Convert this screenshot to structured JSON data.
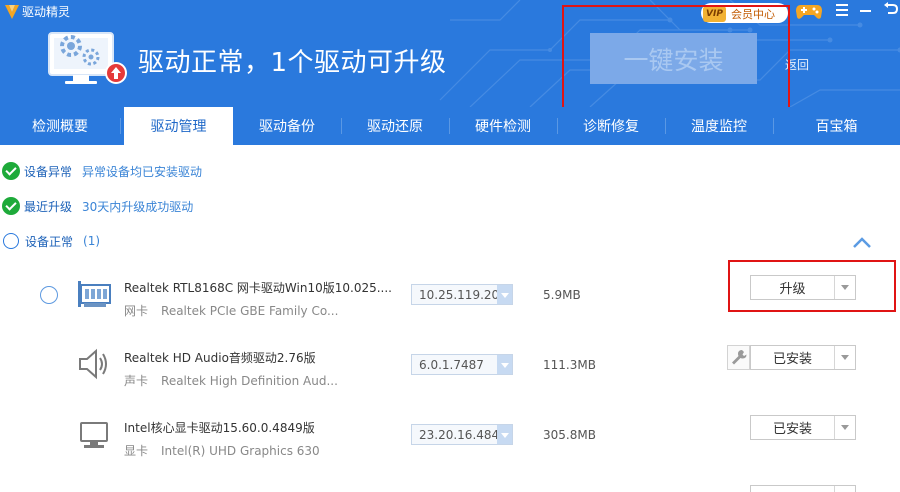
{
  "app": {
    "title": "驱动精灵"
  },
  "header": {
    "status_text": "驱动正常，1个驱动可升级",
    "install_button": "一键安装",
    "return_link": "返回",
    "vip_badge": "VIP",
    "vip_text": "会员中心"
  },
  "tabs": [
    {
      "label": "检测概要",
      "active": false
    },
    {
      "label": "驱动管理",
      "active": true
    },
    {
      "label": "驱动备份",
      "active": false
    },
    {
      "label": "驱动还原",
      "active": false
    },
    {
      "label": "硬件检测",
      "active": false
    },
    {
      "label": "诊断修复",
      "active": false
    },
    {
      "label": "温度监控",
      "active": false
    },
    {
      "label": "百宝箱",
      "active": false
    }
  ],
  "status": [
    {
      "label": "设备异常",
      "value": "异常设备均已安装驱动",
      "icon": "check-circle-icon"
    },
    {
      "label": "最近升级",
      "value": "30天内升级成功驱动",
      "icon": "check-circle-icon"
    },
    {
      "label": "设备正常",
      "value": "(1)",
      "icon": "radio-icon"
    }
  ],
  "drivers": [
    {
      "name": "Realtek RTL8168C 网卡驱动Win10版10.025....",
      "category": "网卡",
      "device": "Realtek PCIe GBE Family Co...",
      "version": "10.25.119.20",
      "size": "5.9MB",
      "action": "升级",
      "icon": "network-card-icon"
    },
    {
      "name": "Realtek HD Audio音频驱动2.76版",
      "category": "声卡",
      "device": "Realtek High Definition Aud...",
      "version": "6.0.1.7487",
      "size": "111.3MB",
      "action": "已安装",
      "icon": "speaker-icon"
    },
    {
      "name": "Intel核心显卡驱动15.60.0.4849版",
      "category": "显卡",
      "device": "Intel(R) UHD Graphics 630",
      "version": "23.20.16.484",
      "size": "305.8MB",
      "action": "已安装",
      "icon": "monitor-icon"
    }
  ],
  "colors": {
    "header_blue": "#2a79dd",
    "highlight_red": "#e01414",
    "check_green": "#1eaa3a"
  }
}
